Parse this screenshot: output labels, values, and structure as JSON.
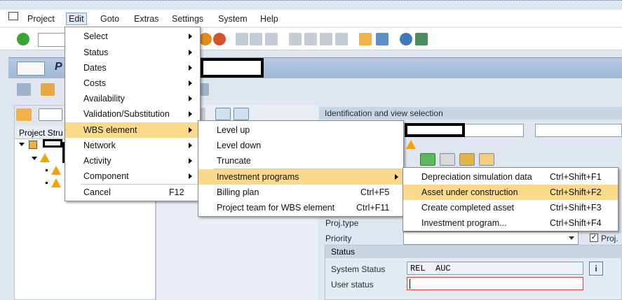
{
  "menubar": {
    "items": [
      "Project",
      "Edit",
      "Goto",
      "Extras",
      "Settings",
      "System",
      "Help"
    ]
  },
  "title": {
    "text": "P"
  },
  "left_pane": {
    "header": "Project Stru"
  },
  "right_pane": {
    "section_title": "Identification and view selection",
    "proj_type_label": "Proj.type",
    "priority_label": "Priority",
    "proj_s_label": "Proj. s",
    "status_group_title": "Status",
    "system_status_label": "System Status",
    "system_status_value": "REL  AUC",
    "user_status_label": "User status",
    "user_status_value": ""
  },
  "edit_menu": {
    "items": [
      {
        "label": "Select",
        "submenu": true,
        "shortcut": ""
      },
      {
        "label": "Status",
        "submenu": true,
        "shortcut": ""
      },
      {
        "label": "Dates",
        "submenu": true,
        "shortcut": ""
      },
      {
        "label": "Costs",
        "submenu": true,
        "shortcut": ""
      },
      {
        "label": "Availability",
        "submenu": true,
        "shortcut": ""
      },
      {
        "label": "Validation/Substitution",
        "submenu": true,
        "shortcut": ""
      },
      {
        "label": "WBS element",
        "submenu": true,
        "shortcut": ""
      },
      {
        "label": "Network",
        "submenu": true,
        "shortcut": ""
      },
      {
        "label": "Activity",
        "submenu": true,
        "shortcut": ""
      },
      {
        "label": "Component",
        "submenu": true,
        "shortcut": ""
      },
      {
        "label": "Cancel",
        "submenu": false,
        "shortcut": "F12"
      }
    ]
  },
  "wbs_menu": {
    "items": [
      {
        "label": "Level up",
        "submenu": false,
        "shortcut": ""
      },
      {
        "label": "Level down",
        "submenu": false,
        "shortcut": ""
      },
      {
        "label": "Truncate",
        "submenu": false,
        "shortcut": ""
      },
      {
        "label": "Investment programs",
        "submenu": true,
        "shortcut": ""
      },
      {
        "label": "Billing plan",
        "submenu": false,
        "shortcut": "Ctrl+F5"
      },
      {
        "label": "Project team for WBS element",
        "submenu": false,
        "shortcut": "Ctrl+F11"
      }
    ]
  },
  "invest_menu": {
    "items": [
      {
        "label": "Depreciation simulation data",
        "shortcut": "Ctrl+Shift+F1"
      },
      {
        "label": "Asset under construction",
        "shortcut": "Ctrl+Shift+F2"
      },
      {
        "label": "Create completed asset",
        "shortcut": "Ctrl+Shift+F3"
      },
      {
        "label": "Investment program...",
        "shortcut": "Ctrl+Shift+F4"
      }
    ]
  },
  "colors": {
    "menu_highlight": "#fbd98a",
    "warning_icon": "#f2a400",
    "check_icon": "#3aa335"
  }
}
